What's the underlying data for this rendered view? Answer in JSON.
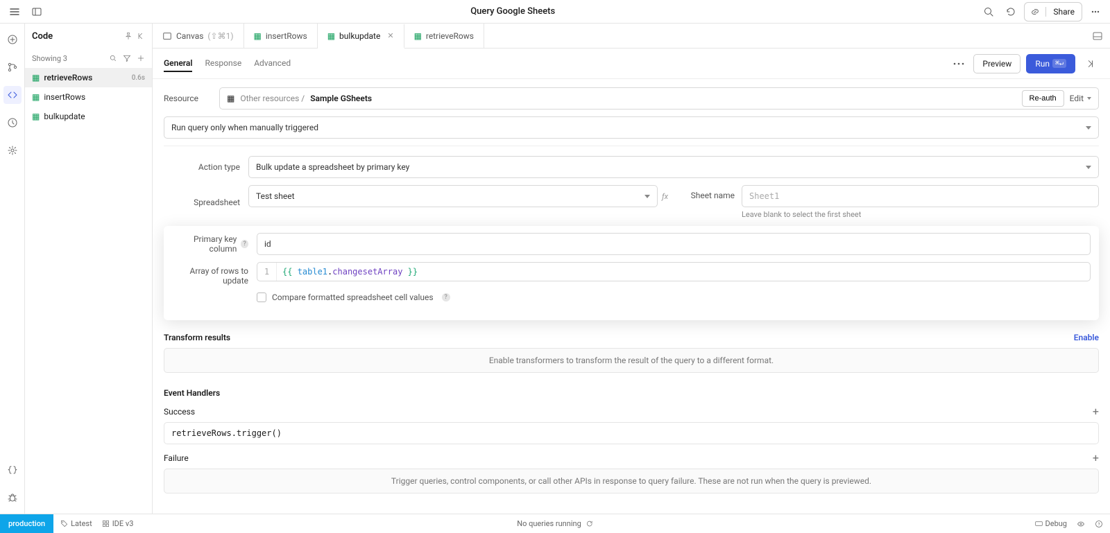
{
  "topbar": {
    "title": "Query Google Sheets",
    "share_label": "Share"
  },
  "code_panel": {
    "header": "Code",
    "showing_label": "Showing 3",
    "items": [
      {
        "name": "retrieveRows",
        "timing": "0.6s"
      },
      {
        "name": "insertRows",
        "timing": ""
      },
      {
        "name": "bulkupdate",
        "timing": ""
      }
    ],
    "selected_index": 0
  },
  "tabs": {
    "canvas_label": "Canvas",
    "canvas_shortcut": "(⇧⌘1)",
    "items": [
      {
        "label": "insertRows",
        "active": false,
        "closable": false
      },
      {
        "label": "bulkupdate",
        "active": true,
        "closable": true
      },
      {
        "label": "retrieveRows",
        "active": false,
        "closable": false
      }
    ]
  },
  "config_tabs": {
    "items": [
      "General",
      "Response",
      "Advanced"
    ],
    "active_index": 0
  },
  "header_buttons": {
    "preview": "Preview",
    "run": "Run",
    "run_shortcut": "⌘↵"
  },
  "resource": {
    "label": "Resource",
    "path_prefix": "Other resources /",
    "name": "Sample GSheets",
    "reauth": "Re-auth",
    "edit": "Edit"
  },
  "run_mode": {
    "value": "Run query only when manually triggered"
  },
  "action_type": {
    "label": "Action type",
    "value": "Bulk update a spreadsheet by primary key"
  },
  "spreadsheet": {
    "label": "Spreadsheet",
    "value": "Test sheet"
  },
  "sheet_name": {
    "label": "Sheet name",
    "placeholder": "Sheet1",
    "helper": "Leave blank to select the first sheet"
  },
  "primary_key": {
    "label": "Primary key column",
    "value": "id"
  },
  "rows_update": {
    "label": "Array of rows to update",
    "gutter": "1",
    "expr_open": "{{ ",
    "expr_obj": "table1",
    "expr_dot": ".",
    "expr_prop": "changesetArray",
    "expr_close": " }}"
  },
  "compare_checkbox": {
    "label": "Compare formatted spreadsheet cell values"
  },
  "transform": {
    "title": "Transform results",
    "enable": "Enable",
    "banner": "Enable transformers to transform the result of the query to a different format."
  },
  "event_handlers": {
    "title": "Event Handlers",
    "success_label": "Success",
    "success_code": "retrieveRows.trigger()",
    "failure_label": "Failure",
    "failure_banner": "Trigger queries, control components, or call other APIs in response to query failure. These are not run when the query is previewed."
  },
  "statusbar": {
    "env": "production",
    "latest": "Latest",
    "ide": "IDE v3",
    "center": "No queries running",
    "debug": "Debug"
  }
}
